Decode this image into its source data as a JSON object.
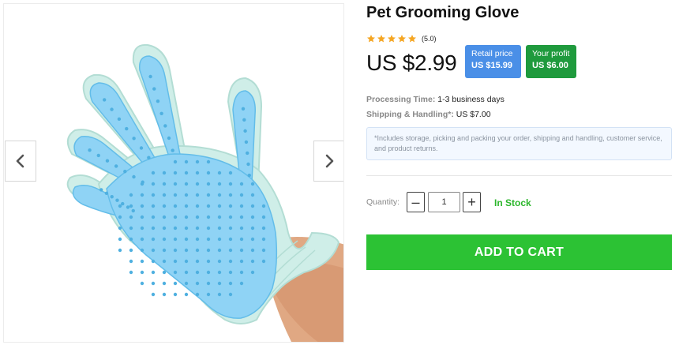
{
  "gallery": {
    "prev_icon": "chevron-left-icon",
    "next_icon": "chevron-right-icon"
  },
  "product": {
    "title": "Pet Grooming Glove",
    "rating": 5.0,
    "rating_text": "(5.0)",
    "star_color": "#f5a623",
    "price": "US $2.99"
  },
  "badges": {
    "retail_label": "Retail price",
    "retail_value": "US $15.99",
    "retail_color": "#4a8fe7",
    "profit_label": "Your profit",
    "profit_value": "US $6.00",
    "profit_color": "#1f9a3d"
  },
  "shipping": {
    "processing_label": "Processing Time:",
    "processing_value": "1-3 business days",
    "handling_label": "Shipping & Handling*:",
    "handling_value": "US $7.00",
    "note": "*Includes storage, picking and packing your order, shipping and handling, customer service, and product returns."
  },
  "quantity": {
    "label": "Quantity:",
    "minus": "–",
    "plus": "+",
    "value": "1",
    "stock_status": "In Stock",
    "stock_color": "#2cb62c"
  },
  "cart": {
    "button_label": "ADD TO CART",
    "button_color": "#2cc234"
  }
}
